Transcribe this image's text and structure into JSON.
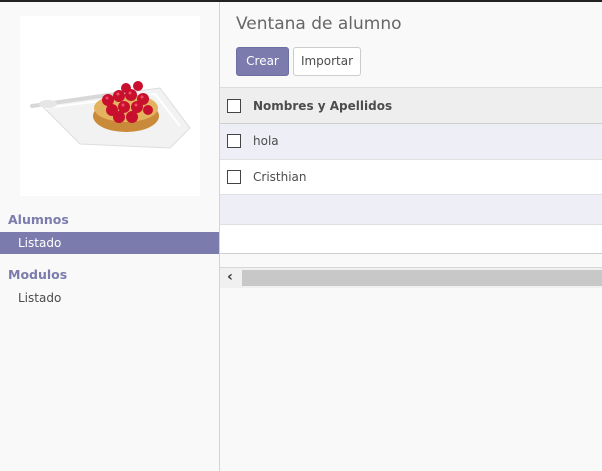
{
  "sidebar": {
    "sections": [
      {
        "title": "Alumnos",
        "items": [
          {
            "label": "Listado",
            "active": true
          }
        ]
      },
      {
        "title": "Modulos",
        "items": [
          {
            "label": "Listado",
            "active": false
          }
        ]
      }
    ]
  },
  "header": {
    "title": "Ventana de alumno"
  },
  "toolbar": {
    "create_label": "Crear",
    "import_label": "Importar"
  },
  "table": {
    "columns": [
      "Nombres y Apellidos"
    ],
    "rows": [
      [
        "hola"
      ],
      [
        "Cristhian"
      ]
    ]
  },
  "colors": {
    "accent": "#7c7bad"
  }
}
